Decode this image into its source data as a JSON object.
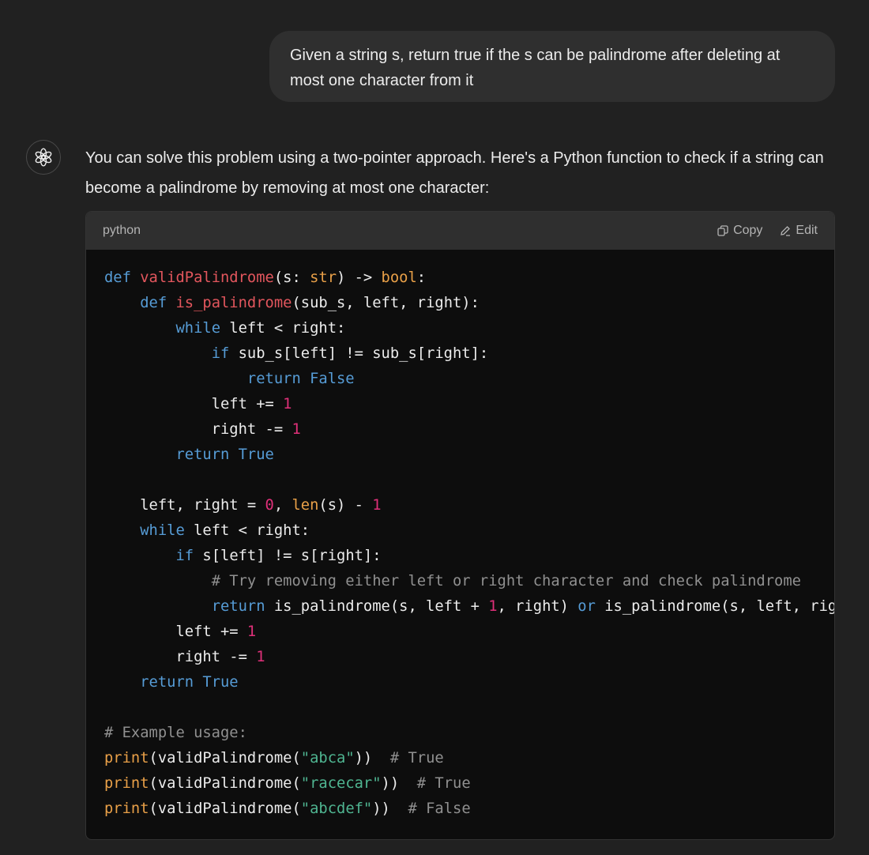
{
  "user_message": "Given a string s, return true if the s can be palindrome after deleting at most one character from it",
  "assistant": {
    "intro": "You can solve this problem using a two-pointer approach. Here's a Python function to check if a string can become a palindrome by removing at most one character:",
    "code_block": {
      "language": "python",
      "copy_label": "Copy",
      "edit_label": "Edit",
      "lines": [
        [
          {
            "t": "def",
            "c": "kw"
          },
          {
            "t": " "
          },
          {
            "t": "validPalindrome",
            "c": "fn"
          },
          {
            "t": "(s: "
          },
          {
            "t": "str",
            "c": "bi"
          },
          {
            "t": ") -> "
          },
          {
            "t": "bool",
            "c": "bi"
          },
          {
            "t": ":"
          }
        ],
        [
          {
            "t": "    "
          },
          {
            "t": "def",
            "c": "kw"
          },
          {
            "t": " "
          },
          {
            "t": "is_palindrome",
            "c": "fn"
          },
          {
            "t": "(sub_s, left, right):"
          }
        ],
        [
          {
            "t": "        "
          },
          {
            "t": "while",
            "c": "kw"
          },
          {
            "t": " left < right:"
          }
        ],
        [
          {
            "t": "            "
          },
          {
            "t": "if",
            "c": "kw"
          },
          {
            "t": " sub_s[left] != sub_s[right]:"
          }
        ],
        [
          {
            "t": "                "
          },
          {
            "t": "return",
            "c": "kw"
          },
          {
            "t": " "
          },
          {
            "t": "False",
            "c": "kw"
          }
        ],
        [
          {
            "t": "            left += "
          },
          {
            "t": "1",
            "c": "num"
          }
        ],
        [
          {
            "t": "            right -= "
          },
          {
            "t": "1",
            "c": "num"
          }
        ],
        [
          {
            "t": "        "
          },
          {
            "t": "return",
            "c": "kw"
          },
          {
            "t": " "
          },
          {
            "t": "True",
            "c": "kw"
          }
        ],
        [],
        [
          {
            "t": "    left, right = "
          },
          {
            "t": "0",
            "c": "num"
          },
          {
            "t": ", "
          },
          {
            "t": "len",
            "c": "bi"
          },
          {
            "t": "(s) - "
          },
          {
            "t": "1",
            "c": "num"
          }
        ],
        [
          {
            "t": "    "
          },
          {
            "t": "while",
            "c": "kw"
          },
          {
            "t": " left < right:"
          }
        ],
        [
          {
            "t": "        "
          },
          {
            "t": "if",
            "c": "kw"
          },
          {
            "t": " s[left] != s[right]:"
          }
        ],
        [
          {
            "t": "            "
          },
          {
            "t": "# Try removing either left or right character and check palindrome",
            "c": "cm"
          }
        ],
        [
          {
            "t": "            "
          },
          {
            "t": "return",
            "c": "kw"
          },
          {
            "t": " is_palindrome(s, left + "
          },
          {
            "t": "1",
            "c": "num"
          },
          {
            "t": ", right) "
          },
          {
            "t": "or",
            "c": "kw"
          },
          {
            "t": " is_palindrome(s, left, righ"
          }
        ],
        [
          {
            "t": "        left += "
          },
          {
            "t": "1",
            "c": "num"
          }
        ],
        [
          {
            "t": "        right -= "
          },
          {
            "t": "1",
            "c": "num"
          }
        ],
        [
          {
            "t": "    "
          },
          {
            "t": "return",
            "c": "kw"
          },
          {
            "t": " "
          },
          {
            "t": "True",
            "c": "kw"
          }
        ],
        [],
        [
          {
            "t": "# Example usage:",
            "c": "cm"
          }
        ],
        [
          {
            "t": "print",
            "c": "bi"
          },
          {
            "t": "(validPalindrome("
          },
          {
            "t": "\"abca\"",
            "c": "str"
          },
          {
            "t": "))  "
          },
          {
            "t": "# True",
            "c": "cm"
          }
        ],
        [
          {
            "t": "print",
            "c": "bi"
          },
          {
            "t": "(validPalindrome("
          },
          {
            "t": "\"racecar\"",
            "c": "str"
          },
          {
            "t": "))  "
          },
          {
            "t": "# True",
            "c": "cm"
          }
        ],
        [
          {
            "t": "print",
            "c": "bi"
          },
          {
            "t": "(validPalindrome("
          },
          {
            "t": "\"abcdef\"",
            "c": "str"
          },
          {
            "t": "))  "
          },
          {
            "t": "# False",
            "c": "cm"
          }
        ]
      ]
    }
  },
  "icons": {
    "assistant_avatar": "openai-logo-icon",
    "copy": "copy-icon",
    "edit": "pencil-icon"
  }
}
